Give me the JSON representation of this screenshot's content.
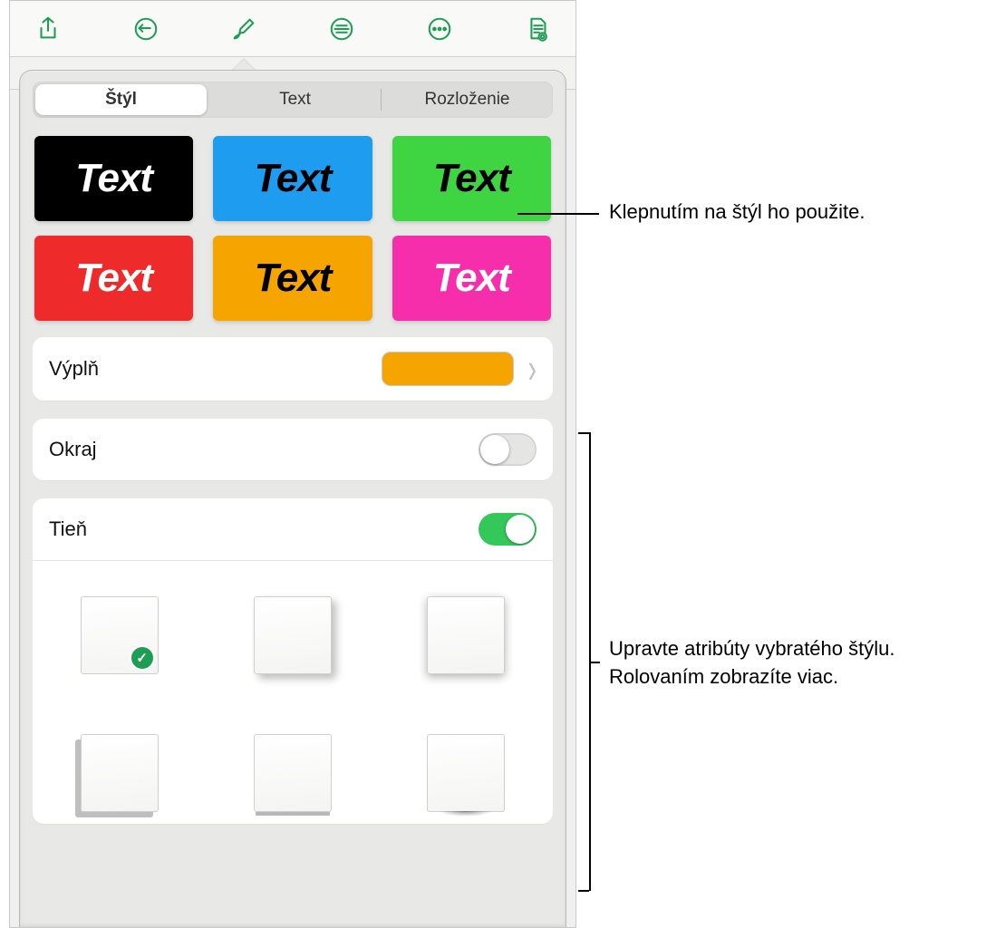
{
  "segments": {
    "style": "Štýl",
    "text": "Text",
    "layout": "Rozloženie"
  },
  "swatches": [
    {
      "bg": "#000000",
      "fg": "#ffffff",
      "label": "Text"
    },
    {
      "bg": "#1e9cf0",
      "fg": "#000000",
      "label": "Text"
    },
    {
      "bg": "#3ed442",
      "fg": "#000000",
      "label": "Text"
    },
    {
      "bg": "#ee2b2a",
      "fg": "#ffffff",
      "label": "Text"
    },
    {
      "bg": "#f6a500",
      "fg": "#000000",
      "label": "Text"
    },
    {
      "bg": "#f72eab",
      "fg": "#ffffff",
      "label": "Text"
    }
  ],
  "fill": {
    "label": "Výplň",
    "color": "#f6a500"
  },
  "border": {
    "label": "Okraj",
    "on": false
  },
  "shadow": {
    "label": "Tieň",
    "on": true
  },
  "callouts": {
    "tap": "Klepnutím na štýl ho použite.",
    "edit": "Upravte atribúty vybratého štýlu. Rolovaním zobrazíte viac."
  }
}
